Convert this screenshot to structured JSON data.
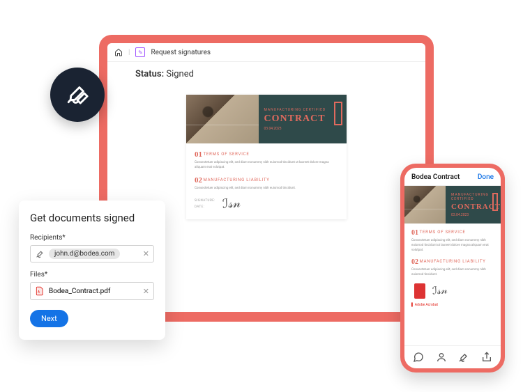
{
  "topbar": {
    "title": "Request signatures"
  },
  "status": {
    "label": "Status:",
    "value": "Signed"
  },
  "doc": {
    "tag": "MANUFACTURING CERTIFIED",
    "title": "CONTRACT",
    "date": "03.04.2023",
    "sections": [
      {
        "num": "01",
        "title": "TERMS OF SERVICE",
        "text": "Consectetuer adipiscing elit, sed diam nonummy nibh euismod tincidunt ut laoreet dolore magna aliquam erat volutpat."
      },
      {
        "num": "02",
        "title": "MANUFACTURING LIABILITY",
        "text": "Consectetuer adipiscing elit, sed diam nonummy nibh euismod tincidunt."
      }
    ],
    "sig_labels": "SIGNATURE:\nDATE:"
  },
  "dialog": {
    "title": "Get documents signed",
    "recipients_label": "Recipients*",
    "recipient": "john.d@bodea.com",
    "files_label": "Files*",
    "file": "Bodea_Contract.pdf",
    "next": "Next"
  },
  "phone": {
    "title": "Bodea Contract",
    "done": "Done"
  }
}
